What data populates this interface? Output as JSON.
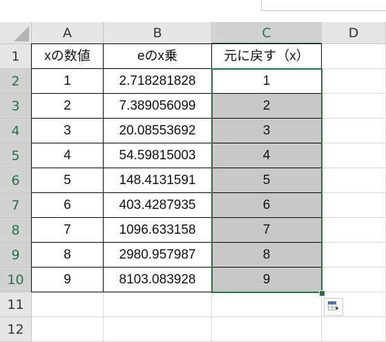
{
  "columns": [
    "A",
    "B",
    "C",
    "D"
  ],
  "rows": [
    "1",
    "2",
    "3",
    "4",
    "5",
    "6",
    "7",
    "8",
    "9",
    "10",
    "11",
    "12"
  ],
  "header": {
    "a": "xの数値",
    "b": "eのx乗",
    "c": "元に戻す（x）"
  },
  "data": [
    {
      "a": "1",
      "b": "2.718281828",
      "c": "1"
    },
    {
      "a": "2",
      "b": "7.389056099",
      "c": "2"
    },
    {
      "a": "3",
      "b": "20.08553692",
      "c": "3"
    },
    {
      "a": "4",
      "b": "54.59815003",
      "c": "4"
    },
    {
      "a": "5",
      "b": "148.4131591",
      "c": "5"
    },
    {
      "a": "6",
      "b": "403.4287935",
      "c": "6"
    },
    {
      "a": "7",
      "b": "1096.633158",
      "c": "7"
    },
    {
      "a": "8",
      "b": "2980.957987",
      "c": "8"
    },
    {
      "a": "9",
      "b": "8103.083928",
      "c": "9"
    }
  ],
  "selected_column": "C",
  "selection_color": "#217346",
  "quick_analysis_icon": "quick-analysis-icon"
}
